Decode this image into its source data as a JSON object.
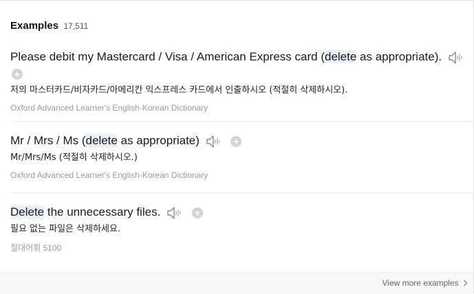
{
  "header": {
    "title": "Examples",
    "count": "17,511"
  },
  "examples": [
    {
      "pre": "Please debit my Mastercard / Visa / American Express card (",
      "highlight": "delete",
      "post": " as appropriate).",
      "translation": "저의 마스터카드/비자카드/아메리칸 익스프레스 카드에서 인출하시오 (적절히 삭제하시오).",
      "source": "Oxford Advanced Learner's English-Korean Dictionary"
    },
    {
      "pre": "Mr / Mrs / Ms (",
      "highlight": "delete",
      "post": " as appropriate)",
      "translation": "Mr/Mrs/Ms (적절히 삭제하시오.)",
      "source": "Oxford Advanced Learner's English-Korean Dictionary"
    },
    {
      "pre": "",
      "highlight": "Delete",
      "post": " the unnecessary files.",
      "translation": "필요 없는 파일은 삭제하세요.",
      "source": "절대어휘 5100"
    }
  ],
  "footer": {
    "view_more": "View more examples"
  },
  "icons": {
    "speaker": "speaker-icon",
    "add": "plus-icon",
    "more": "chevron-right-icon"
  }
}
